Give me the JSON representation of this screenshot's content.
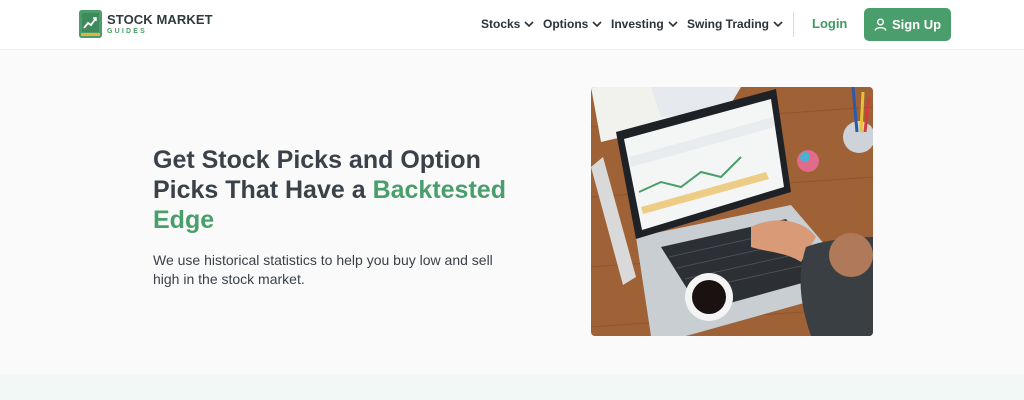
{
  "brand": {
    "title": "STOCK MARKET",
    "subtitle": "GUIDES",
    "accent_color": "#4a9e6b",
    "icon": "chart-trend-icon"
  },
  "nav": {
    "items": [
      {
        "label": "Stocks"
      },
      {
        "label": "Options"
      },
      {
        "label": "Investing"
      },
      {
        "label": "Swing Trading"
      }
    ],
    "login_label": "Login",
    "signup_label": "Sign Up"
  },
  "hero": {
    "title_part1": "Get Stock Picks and Option Picks That Have a ",
    "title_accent": "Backtested Edge",
    "subtitle": "We use historical statistics to help you buy low and sell high in the stock market.",
    "image": "photo-laptop-on-desk"
  }
}
